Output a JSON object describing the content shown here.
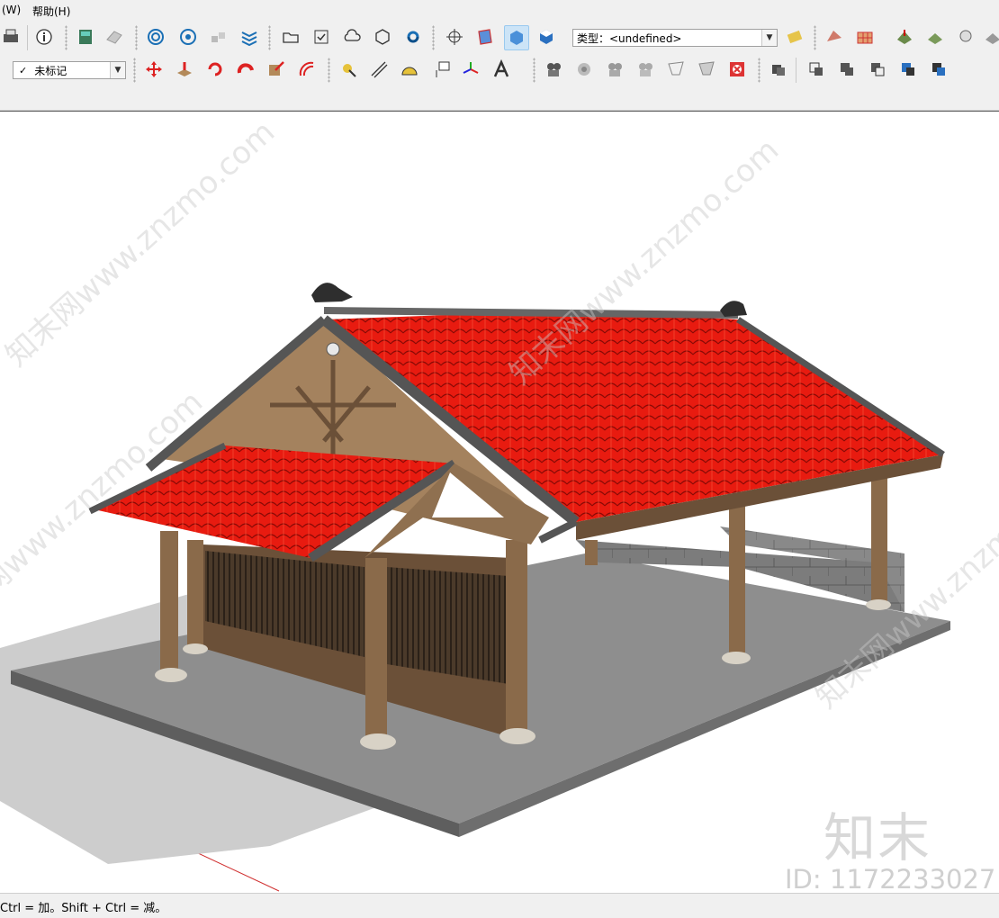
{
  "menu": {
    "window_label": "(W)",
    "help_label": "帮助(H)"
  },
  "toolbar": {
    "type_dropdown": {
      "value": "类型：<undefined>"
    },
    "tag_dropdown": {
      "value": "未标记",
      "check": "✓"
    }
  },
  "status": {
    "hint": "Ctrl = 加。Shift + Ctrl = 减。"
  },
  "watermark": {
    "logo": "知末",
    "id": "ID: 1172233027",
    "site": "知末网www.znzmo.com"
  },
  "colors": {
    "roof": "#e81b10",
    "wood": "#8a6a4a",
    "floor": "#8e8e8e",
    "wall": "#7a7a7a"
  }
}
